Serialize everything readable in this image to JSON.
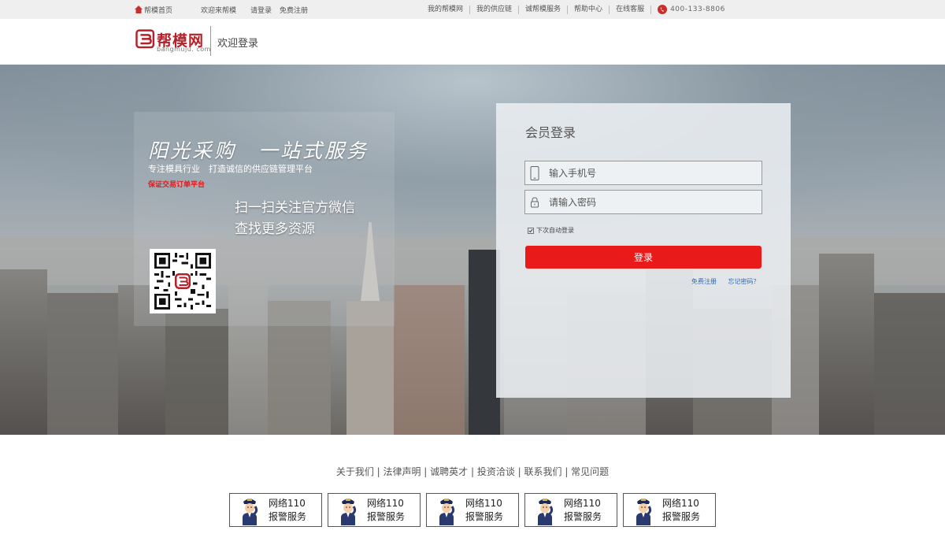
{
  "topbar": {
    "home": "帮模首页",
    "welcome": "欢迎来帮模",
    "login": "请登录",
    "register": "免费注册",
    "links": [
      "我的帮模网",
      "我的供应链",
      "诚帮模服务",
      "帮助中心",
      "在线客服"
    ],
    "phone": "400-133-8806"
  },
  "header": {
    "logo_text": "帮模网",
    "logo_sub": "bangmuju. com",
    "title": "欢迎登录"
  },
  "promo": {
    "slogan": "阳光采购　一站式服务",
    "subslogan": "专注模具行业　打造诚信的供应链管理平台",
    "redline": "保证交易订单平台",
    "qr_line1": "扫一扫关注官方微信",
    "qr_line2": "查找更多资源"
  },
  "login": {
    "title": "会员登录",
    "phone_placeholder": "输入手机号",
    "password_placeholder": "请输入密码",
    "remember": "下次自动登录",
    "button": "登录",
    "register_link": "免费注册",
    "forgot_link": "忘记密码？"
  },
  "footer": {
    "links": "关于我们 | 法律声明 | 诚聘英才 | 投资洽谈 | 联系我们 | 常见问题",
    "badges": [
      {
        "line1": "网络110",
        "line2": "报警服务"
      },
      {
        "line1": "网络110",
        "line2": "报警服务"
      },
      {
        "line1": "网络110",
        "line2": "报警服务"
      },
      {
        "line1": "网络110",
        "line2": "报警服务"
      },
      {
        "line1": "网络110",
        "line2": "报警服务"
      }
    ]
  },
  "colors": {
    "brand_red": "#b5212a",
    "button_red": "#e81a1a",
    "link_blue": "#3468b0"
  }
}
